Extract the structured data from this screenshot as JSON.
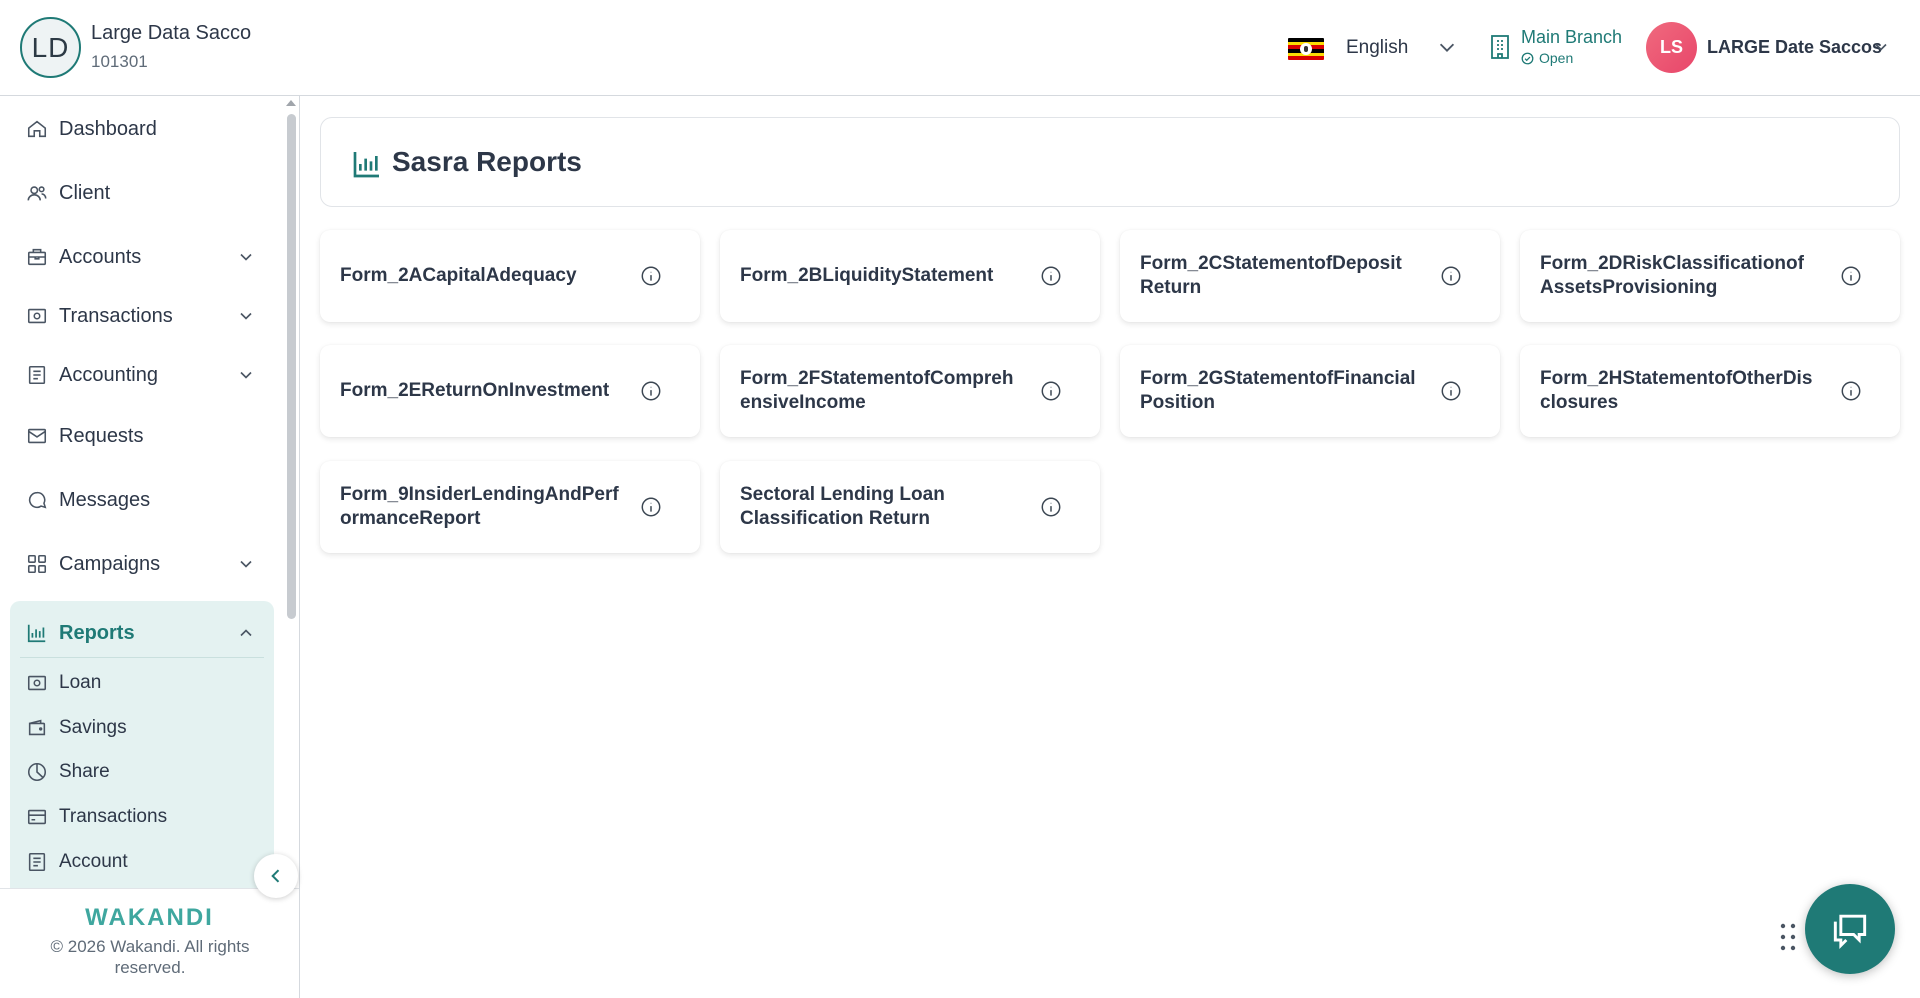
{
  "header": {
    "org_initials": "LD",
    "org_name": "Large Data Sacco",
    "org_code": "101301",
    "language": "English",
    "branch_name": "Main Branch",
    "branch_status": "Open",
    "user_initials": "LS",
    "user_name": "LARGE Date Saccos"
  },
  "sidebar": {
    "items": [
      {
        "label": "Dashboard",
        "icon": "home-icon"
      },
      {
        "label": "Client",
        "icon": "users-icon"
      },
      {
        "label": "Accounts",
        "icon": "briefcase-icon"
      },
      {
        "label": "Transactions",
        "icon": "cash-icon"
      },
      {
        "label": "Accounting",
        "icon": "ledger-icon"
      },
      {
        "label": "Requests",
        "icon": "mail-icon"
      },
      {
        "label": "Messages",
        "icon": "chat-bubble-icon"
      },
      {
        "label": "Campaigns",
        "icon": "grid-icon"
      }
    ],
    "reports": {
      "label": "Reports",
      "sub_items": [
        {
          "label": "Loan",
          "icon": "cash-icon"
        },
        {
          "label": "Savings",
          "icon": "wallet-icon"
        },
        {
          "label": "Share",
          "icon": "pie-chart-icon"
        },
        {
          "label": "Transactions",
          "icon": "card-icon"
        },
        {
          "label": "Account",
          "icon": "ledger-icon"
        }
      ]
    },
    "brand": "WAKANDI",
    "copyright": "© 2026 Wakandi. All rights reserved."
  },
  "main": {
    "title": "Sasra Reports",
    "reports": [
      "Form_2ACapitalAdequacy",
      "Form_2BLiquidityStatement",
      "Form_2CStatementofDeposit Return",
      "Form_2DRiskClassificationof AssetsProvisioning",
      "Form_2EReturnOnInvestment",
      "Form_2FStatementofComprehensiveIncome",
      "Form_2GStatementofFinancialPosition",
      "Form_2HStatementofOtherDisclosures",
      "Form_9InsiderLendingAndPerformanceReport",
      "Sectoral Lending Loan Classification Return"
    ]
  },
  "colors": {
    "accent": "#1f7a76",
    "accent_light": "#e4f2f1",
    "avatar_pink": "#ee5a78"
  }
}
